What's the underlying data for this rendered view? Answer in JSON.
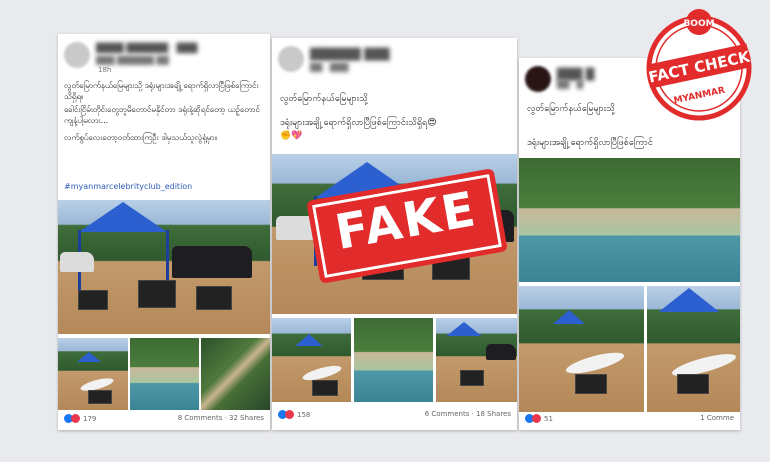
{
  "post1": {
    "time": "18h",
    "title_line": "လွတ်မြောက်နယ်မြေများသို့ ဒရုံးများအချို့ ရောက်ရှိလာပြီဖြစ်ကြောင်းသိရှိရ။",
    "body_line1": "ခေါင်းငြိမ်းတိုင်းတွေဘူမိတောင်မနိုင်တာ ဒရုံးနဲ့ဆိုရင်တော့ ယဥ့်တောင်ကျနံ့ပါ့မလား...",
    "body_line2": "လက်စွပ်လေးတော့ဝတ်ထားကြဦး ဒါမှသယ်သူလွဲရုံ့မှာ။",
    "hashtag": "#myanmarcelebrityclub_edition",
    "reaction_count": "179",
    "stats": "8 Comments · 32 Shares"
  },
  "post2": {
    "title_line": "လွတ်မြောက်နယ်မြေများသို့",
    "body_line1": "ဒရုံးများအချို့ ရောက်ရှိလာပြီဖြစ်ကြောင်းသိရှိရ😍",
    "body_line2": "✊💖",
    "reaction_count": "158",
    "stats": "6 Comments · 18 Shares"
  },
  "post3": {
    "title_line": "လွတ်မြောက်နယ်မြေများသို့",
    "body_line1": "ဒရုံးများအချို့ ရောက်ရှိလာပြီဖြစ်ကြောင်",
    "reaction_count": "51",
    "stats": "1 Comme"
  },
  "stamp": {
    "label": "FAKE"
  },
  "badge": {
    "top": "BOOM",
    "main": "FACT CHECK",
    "bottom": "MYANMAR"
  },
  "colors": {
    "red": "#e22b2b",
    "like": "#1877f2",
    "love": "#e8384d",
    "hashtag": "#2d5db6"
  }
}
